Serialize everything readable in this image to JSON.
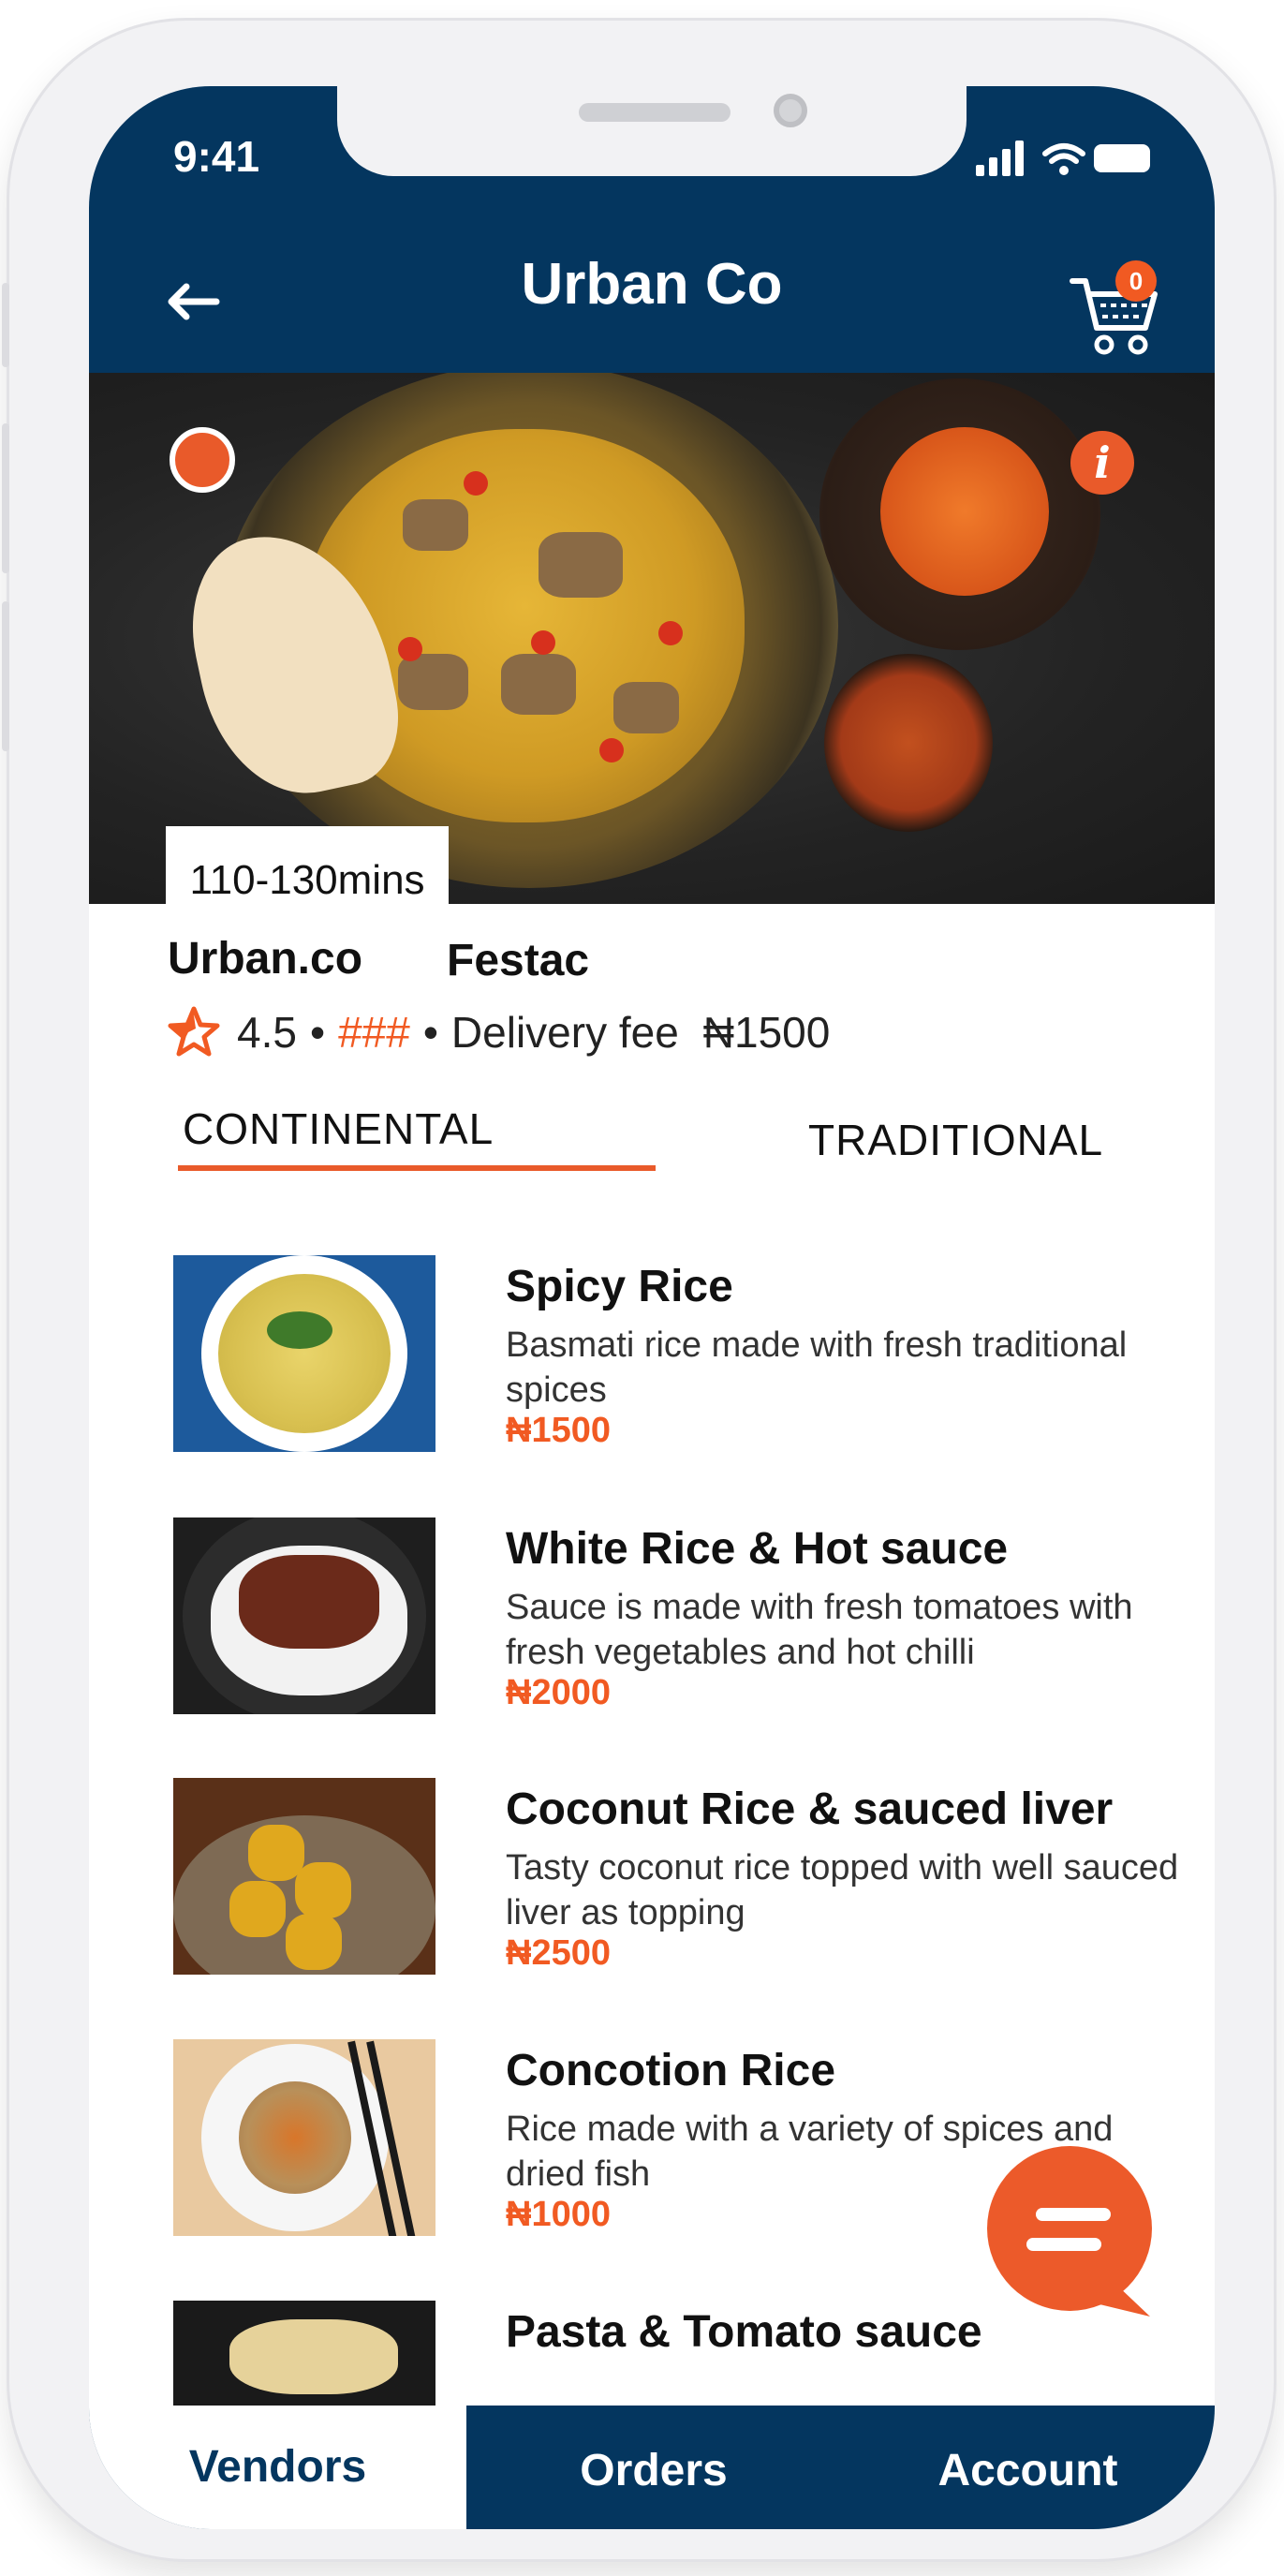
{
  "status_bar": {
    "time": "9:41"
  },
  "header": {
    "title": "Urban Co",
    "cart_count": "0"
  },
  "hero": {
    "eta": "110-130mins",
    "info_glyph": "i"
  },
  "vendor": {
    "name": "Urban.co",
    "location": "Festac",
    "rating": "4.5",
    "separator": "•",
    "price_level": "###",
    "delivery_fee_label": "Delivery fee",
    "delivery_fee": "₦1500"
  },
  "tabs": [
    {
      "label": "CONTINENTAL",
      "active": true
    },
    {
      "label": "TRADITIONAL",
      "active": false
    }
  ],
  "menu": [
    {
      "name": "Spicy Rice",
      "description": "Basmati rice made with fresh traditional spices",
      "price": "₦1500"
    },
    {
      "name": "White Rice & Hot sauce",
      "description": "Sauce is made with fresh tomatoes with fresh vegetables and hot chilli",
      "price": "₦2000"
    },
    {
      "name": "Coconut Rice & sauced liver",
      "description": "Tasty coconut rice topped with well sauced liver as topping",
      "price": "₦2500"
    },
    {
      "name": "Concotion Rice",
      "description": "Rice made with a variety of spices and dried fish",
      "price": "₦1000"
    },
    {
      "name": "Pasta & Tomato sauce"
    }
  ],
  "bottom_nav": {
    "vendors": "Vendors",
    "orders": "Orders",
    "account": "Account"
  },
  "colors": {
    "primary": "#04365f",
    "accent": "#f15a22",
    "background": "#ffffff"
  },
  "icons": [
    "back-arrow-icon",
    "cart-icon",
    "favorite-icon",
    "info-icon",
    "star-icon",
    "chat-icon",
    "signal-icon",
    "wifi-icon",
    "battery-icon"
  ]
}
